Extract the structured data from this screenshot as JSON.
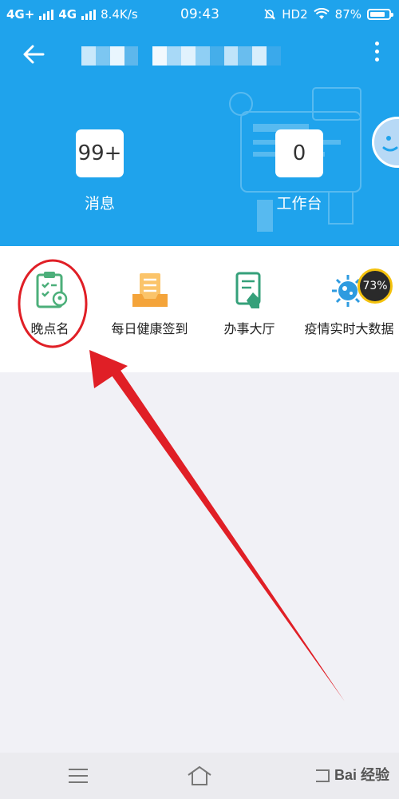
{
  "status_bar": {
    "network1": "4G+",
    "network2": "4G",
    "speed": "8.4K/s",
    "time": "09:43",
    "hd": "HD2",
    "battery": "87%"
  },
  "header": {
    "background": "#1fa3ec"
  },
  "stats": [
    {
      "value": "99+",
      "label": "消息"
    },
    {
      "value": "0",
      "label": "工作台"
    }
  ],
  "menu": [
    {
      "label": "晚点名",
      "icon": "clipboard-location-icon"
    },
    {
      "label": "每日健康签到",
      "icon": "inbox-document-icon"
    },
    {
      "label": "办事大厅",
      "icon": "document-hand-icon"
    },
    {
      "label": "疫情实时大数据",
      "icon": "virus-icon"
    }
  ],
  "overlay": {
    "percent": "73%"
  },
  "watermark": "Bai 经验"
}
